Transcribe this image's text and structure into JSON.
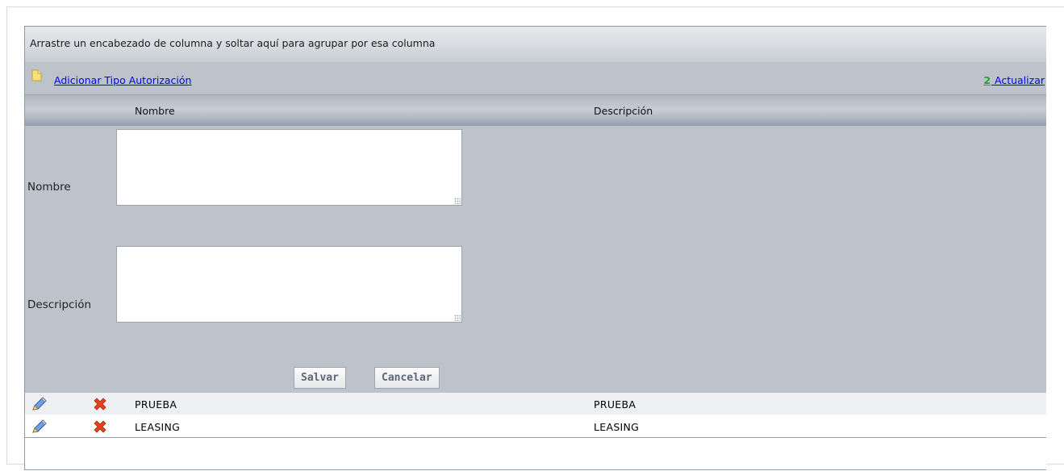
{
  "group_panel": {
    "text": "Arrastre un encabezado de columna y soltar aquí para agrupar por esa columna"
  },
  "command_bar": {
    "add_label": "Adicionar Tipo Autorización",
    "add_icon": "document-add-icon",
    "refresh_label": "Actualizar",
    "refresh_icon": "refresh-icon",
    "refresh_glyph": "2"
  },
  "columns": {
    "nombre": "Nombre",
    "descripcion": "Descripción"
  },
  "edit_form": {
    "nombre_label": "Nombre",
    "nombre_value": "",
    "descripcion_label": "Descripción",
    "descripcion_value": "",
    "save_label": "Salvar",
    "cancel_label": "Cancelar"
  },
  "rows": [
    {
      "nombre": "PRUEBA",
      "descripcion": "PRUEBA",
      "edit_icon": "pencil-icon",
      "delete_icon": "delete-x-icon"
    },
    {
      "nombre": "LEASING",
      "descripcion": "LEASING",
      "edit_icon": "pencil-icon",
      "delete_icon": "delete-x-icon"
    }
  ],
  "colors": {
    "grid_background": "#bcc3cb",
    "link": "#0000ee",
    "delete_icon": "#e8401c",
    "refresh_icon": "#2aa12a"
  }
}
